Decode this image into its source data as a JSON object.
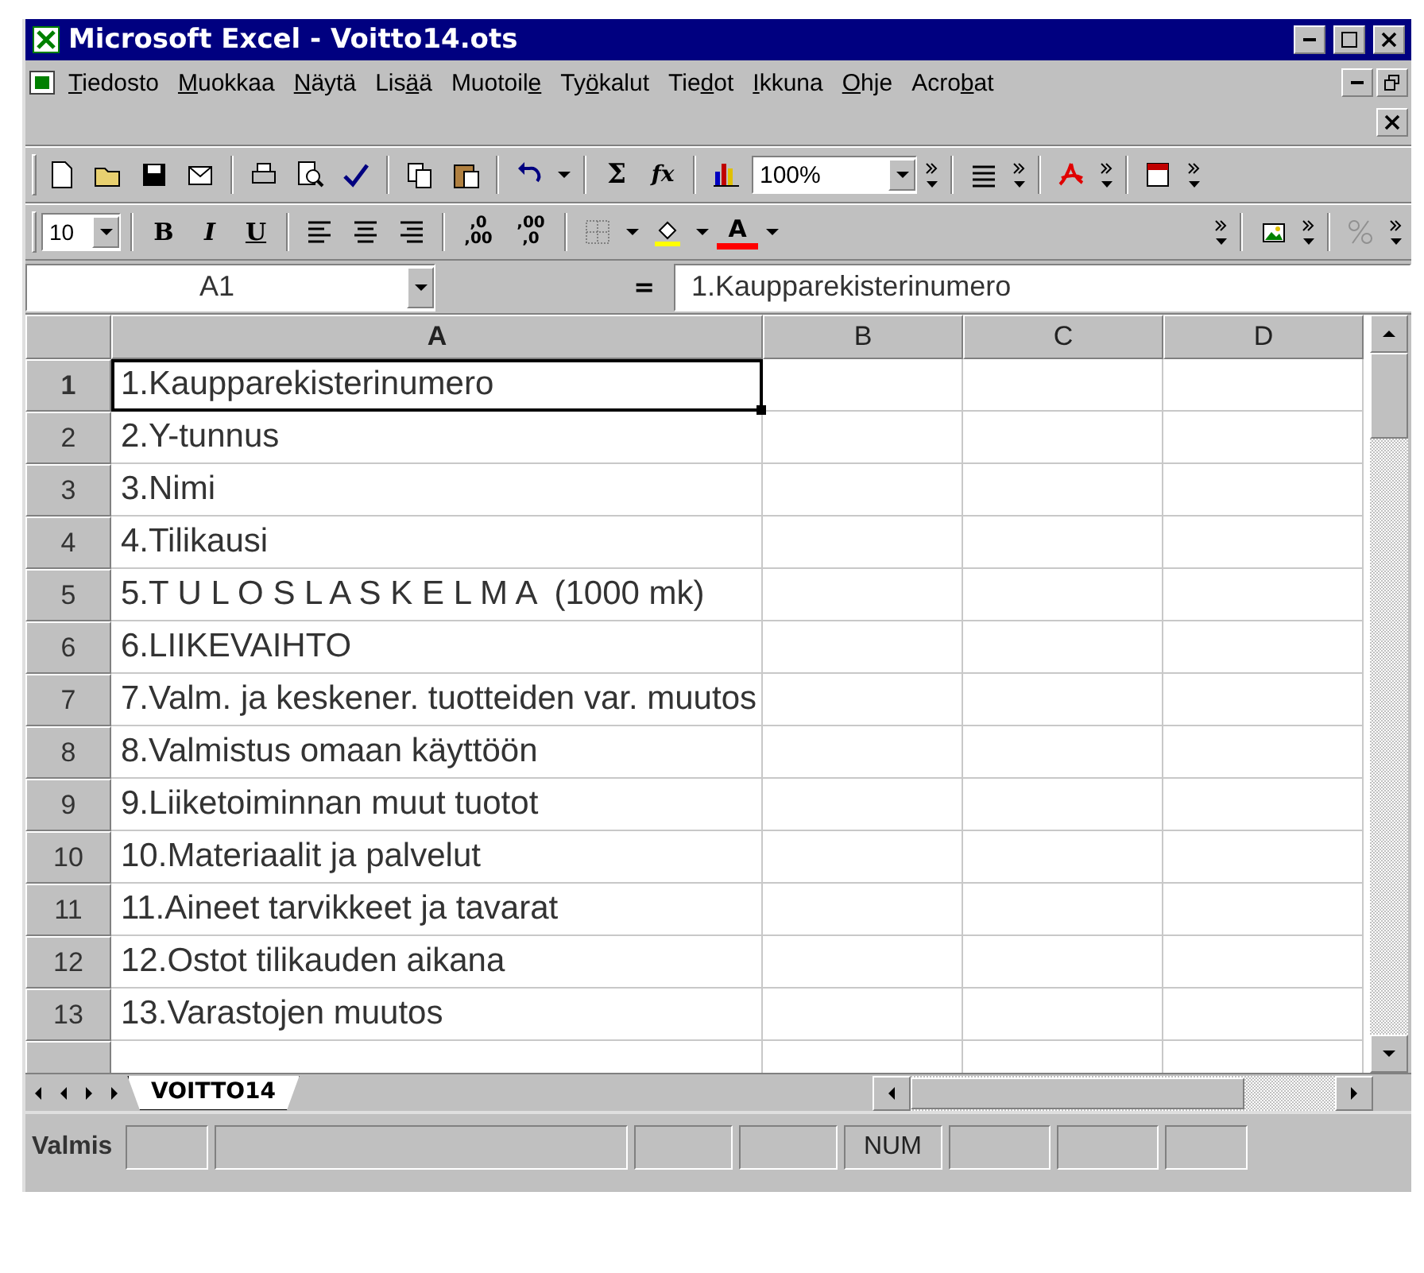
{
  "window": {
    "title": "Microsoft Excel - Voitto14.ots"
  },
  "menu": [
    {
      "key": "T",
      "after": "iedosto"
    },
    {
      "key": "M",
      "after": "uokkaa"
    },
    {
      "key": "N",
      "after": "äytä"
    },
    {
      "before": "Lis",
      "key": "ä",
      "after": "ä"
    },
    {
      "before": "Muotoil",
      "key": "e"
    },
    {
      "before": "Ty",
      "key": "ö",
      "after": "kalut"
    },
    {
      "before": "Tie",
      "key": "d",
      "after": "ot"
    },
    {
      "key": "I",
      "after": "kkuna"
    },
    {
      "key": "O",
      "after": "hje"
    },
    {
      "before": "Acro",
      "key": "b",
      "after": "at"
    }
  ],
  "standard_toolbar": {
    "sum": "Σ",
    "function": "fx",
    "zoom": "100%"
  },
  "formatting_toolbar": {
    "font_size": "10",
    "bold": "B",
    "italic": "I",
    "underline": "U",
    "increase_decimal": {
      "top": ",0",
      "bottom": ",00"
    },
    "decrease_decimal": {
      "top": ",00",
      "bottom": ",0"
    },
    "font_color": "A"
  },
  "name_box": "A1",
  "formula_equals": "=",
  "formula": "1.Kaupparekisterinumero",
  "columns": [
    {
      "label": "A",
      "selected": true
    },
    {
      "label": "B",
      "selected": false
    },
    {
      "label": "C",
      "selected": false
    },
    {
      "label": "D",
      "selected": false
    }
  ],
  "rows": [
    {
      "number": "1",
      "selected": true,
      "cells": [
        "1.Kaupparekisterinumero"
      ]
    },
    {
      "number": "2",
      "selected": false,
      "cells": [
        "2.Y-tunnus"
      ]
    },
    {
      "number": "3",
      "selected": false,
      "cells": [
        "3.Nimi"
      ]
    },
    {
      "number": "4",
      "selected": false,
      "cells": [
        "4.Tilikausi"
      ]
    },
    {
      "number": "5",
      "selected": false,
      "cells": [
        "5.T U L O S L A S K E L M A  (1000 mk)"
      ]
    },
    {
      "number": "6",
      "selected": false,
      "cells": [
        "6.LIIKEVAIHTO"
      ]
    },
    {
      "number": "7",
      "selected": false,
      "cells": [
        "7.Valm. ja keskener. tuotteiden var. muutos"
      ]
    },
    {
      "number": "8",
      "selected": false,
      "cells": [
        "8.Valmistus omaan käyttöön"
      ]
    },
    {
      "number": "9",
      "selected": false,
      "cells": [
        "9.Liiketoiminnan muut tuotot"
      ]
    },
    {
      "number": "10",
      "selected": false,
      "cells": [
        "10.Materiaalit ja palvelut"
      ]
    },
    {
      "number": "11",
      "selected": false,
      "cells": [
        "11.Aineet tarvikkeet ja tavarat"
      ]
    },
    {
      "number": "12",
      "selected": false,
      "cells": [
        "12.Ostot tilikauden aikana"
      ]
    },
    {
      "number": "13",
      "selected": false,
      "cells": [
        "13.Varastojen muutos"
      ]
    }
  ],
  "sheet_tabs": [
    {
      "label": "VOITTO14",
      "selected": true
    }
  ],
  "status": {
    "text": "Valmis",
    "num": "NUM"
  }
}
